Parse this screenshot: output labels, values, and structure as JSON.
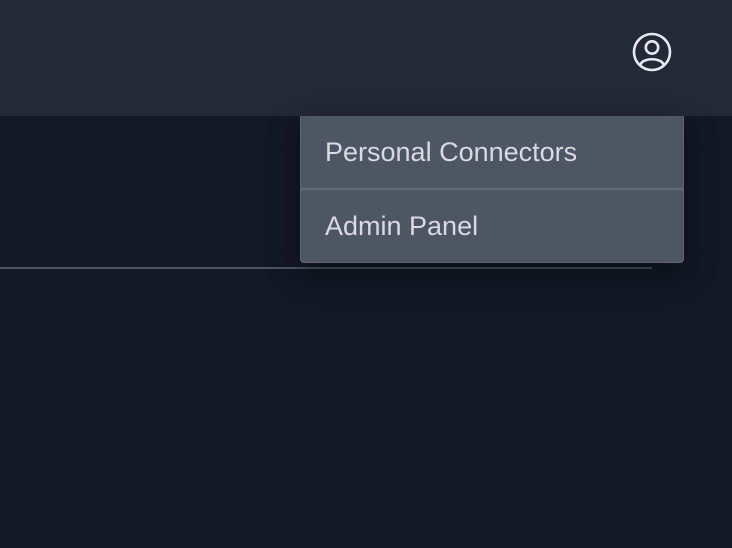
{
  "header": {
    "user_icon": "user-circle-icon"
  },
  "user_menu": {
    "items": [
      {
        "label": "Personal Connectors"
      },
      {
        "label": "Admin Panel"
      }
    ]
  },
  "colors": {
    "header_bg": "#232937",
    "page_bg": "#131825",
    "menu_bg": "#4e5563",
    "menu_text": "#d7dbe2"
  }
}
